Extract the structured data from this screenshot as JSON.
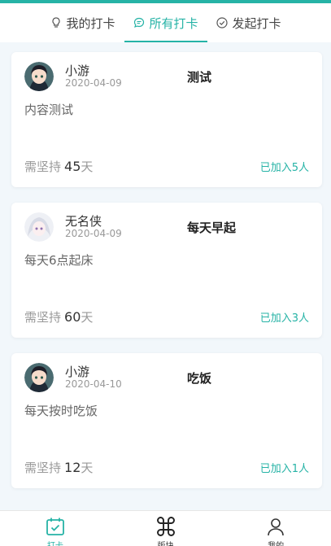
{
  "tabs": [
    {
      "label": "我的打卡",
      "icon": "bulb-icon",
      "active": false
    },
    {
      "label": "所有打卡",
      "icon": "chat-icon",
      "active": true
    },
    {
      "label": "发起打卡",
      "icon": "check-circle-icon",
      "active": false
    }
  ],
  "cards": [
    {
      "user": "小游",
      "date": "2020-04-09",
      "title": "测试",
      "content": "内容测试",
      "persist_prefix": "需坚持",
      "days": "45",
      "days_unit": "天",
      "joined": "已加入5人"
    },
    {
      "user": "无名侠",
      "date": "2020-04-09",
      "title": "每天早起",
      "content": "每天6点起床",
      "persist_prefix": "需坚持",
      "days": "60",
      "days_unit": "天",
      "joined": "已加入3人"
    },
    {
      "user": "小游",
      "date": "2020-04-10",
      "title": "吃饭",
      "content": "每天按时吃饭",
      "persist_prefix": "需坚持",
      "days": "12",
      "days_unit": "天",
      "joined": "已加入1人"
    }
  ],
  "bottom_nav": [
    {
      "label": "打卡",
      "icon": "calendar-check-icon",
      "active": true
    },
    {
      "label": "版块",
      "icon": "command-icon",
      "active": false
    },
    {
      "label": "我的",
      "icon": "person-icon",
      "active": false
    }
  ],
  "colors": {
    "accent": "#26b3a6",
    "background": "#f2f7fb"
  }
}
